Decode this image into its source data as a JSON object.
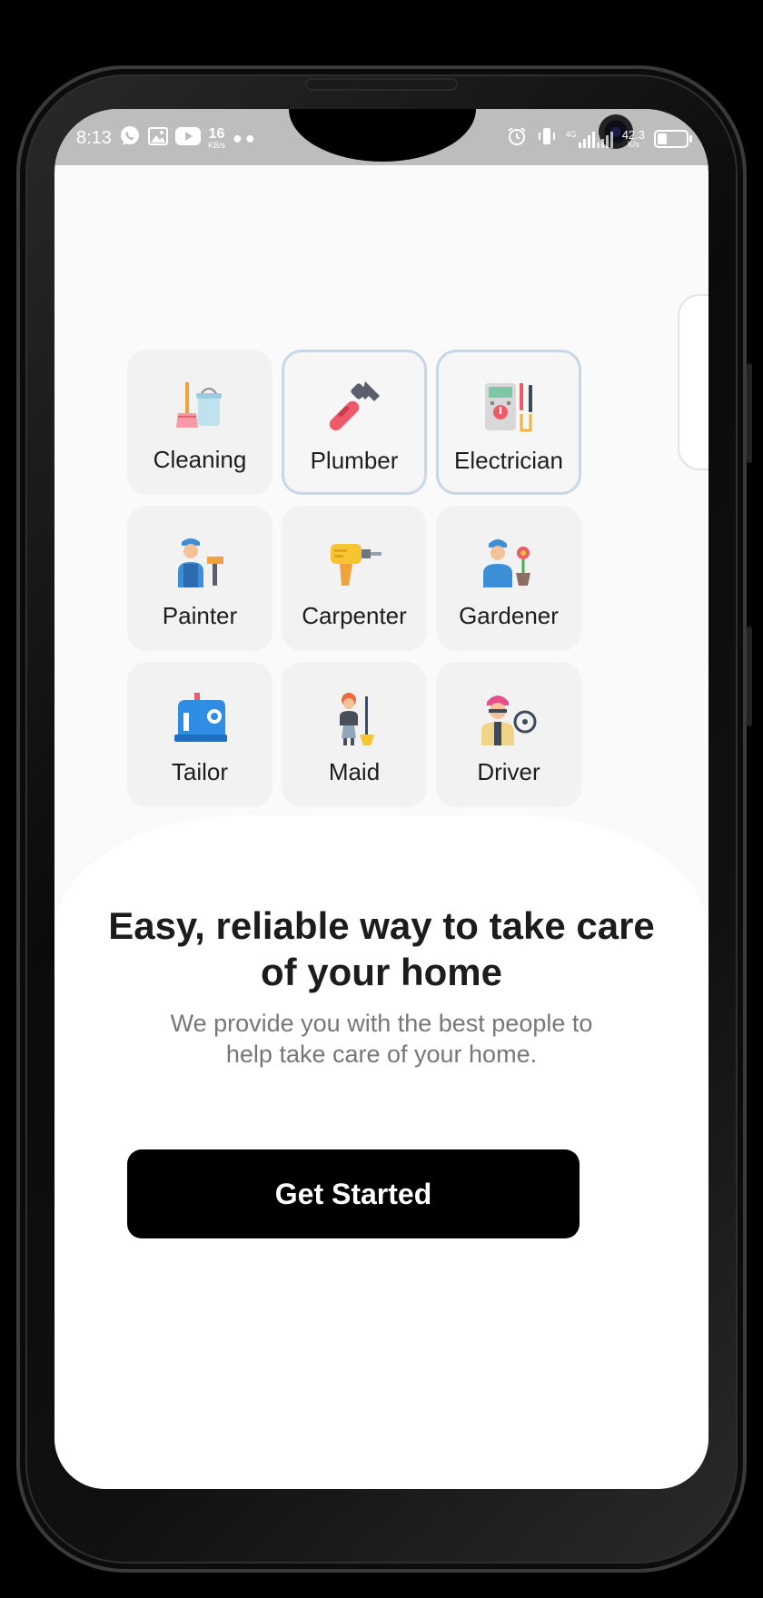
{
  "status_bar": {
    "time": "8:13",
    "net_speed_left": "16",
    "net_speed_left_unit": "KB/s",
    "network_type": "4G",
    "net_speed_right": "42.3",
    "net_speed_right_unit": "K/s",
    "icons": [
      "whatsapp-icon",
      "gallery-icon",
      "youtube-icon",
      "alarm-icon",
      "vibrate-icon",
      "signal-icon",
      "battery-icon"
    ]
  },
  "services": [
    {
      "label": "Cleaning",
      "icon": "cleaning-icon",
      "selected": false
    },
    {
      "label": "Plumber",
      "icon": "wrench-icon",
      "selected": true
    },
    {
      "label": "Electrician",
      "icon": "multimeter-icon",
      "selected": true
    },
    {
      "label": "Painter",
      "icon": "painter-icon",
      "selected": false
    },
    {
      "label": "Carpenter",
      "icon": "drill-icon",
      "selected": false
    },
    {
      "label": "Gardener",
      "icon": "gardener-icon",
      "selected": false
    },
    {
      "label": "Tailor",
      "icon": "sewing-machine-icon",
      "selected": false
    },
    {
      "label": "Maid",
      "icon": "maid-icon",
      "selected": false
    },
    {
      "label": "Driver",
      "icon": "driver-icon",
      "selected": false
    }
  ],
  "intro": {
    "headline": "Easy, reliable way to take care of your home",
    "subtext": "We provide you with the best people to help take care of your home."
  },
  "cta": {
    "label": "Get Started"
  },
  "colors": {
    "tile_bg": "#f2f2f2",
    "tile_selected_border": "#c8d6e6",
    "button_bg": "#000000",
    "headline": "#1c1c1c",
    "subtext": "#777777"
  }
}
